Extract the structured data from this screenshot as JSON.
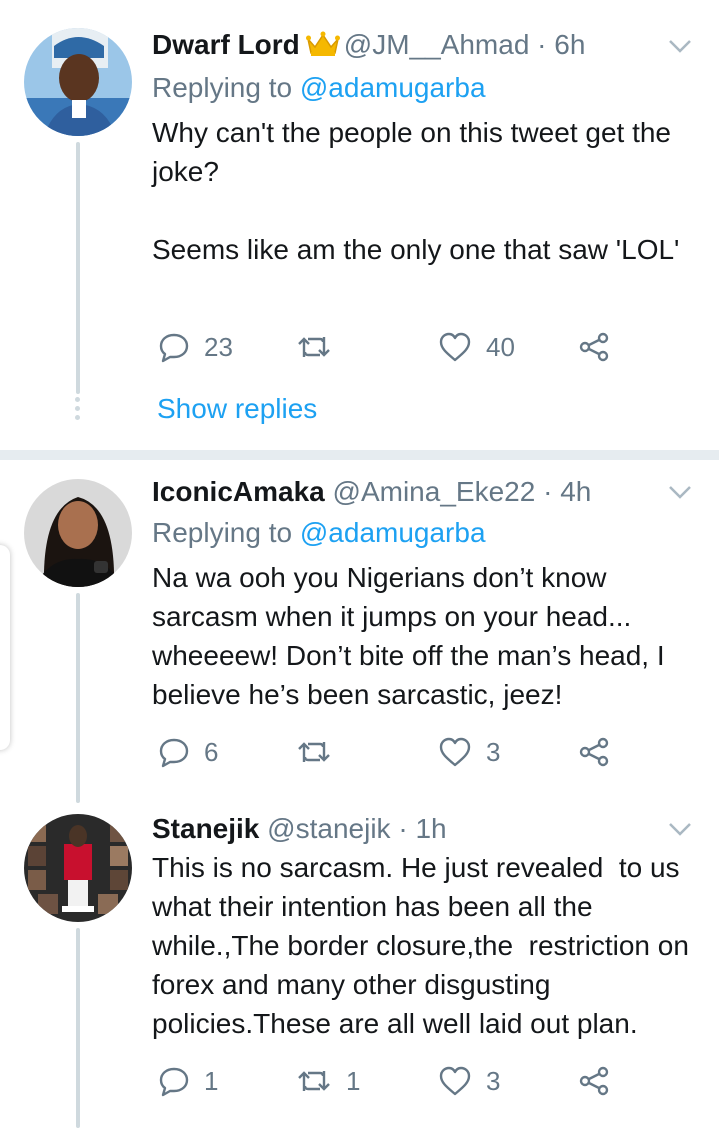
{
  "tweets": [
    {
      "name": "Dwarf Lord",
      "handle": "@JM__Ahmad",
      "time": "6h",
      "replying_prefix": "Replying to",
      "replying_to": "@adamugarba",
      "text": "Why can't the people on this tweet get the joke?\n\nSeems like am the only one that saw 'LOL'",
      "replies": "23",
      "retweets": "",
      "likes": "40",
      "show_replies": "Show replies",
      "icons": [
        "crown-emoji-icon",
        "chevron-down-icon",
        "reply-icon",
        "retweet-icon",
        "like-icon",
        "share-icon"
      ]
    },
    {
      "name": "IconicAmaka",
      "handle": "@Amina_Eke22",
      "time": "4h",
      "replying_prefix": "Replying to",
      "replying_to": "@adamugarba",
      "text": "Na wa ooh you Nigerians don’t know sarcasm when it jumps on your head... wheeeew! Don’t bite off the man’s head, I believe he’s been sarcastic, jeez!",
      "replies": "6",
      "retweets": "",
      "likes": "3"
    },
    {
      "name": "Stanejik",
      "handle": "@stanejik",
      "time": "1h",
      "text": "This is no sarcasm. He just revealed  to us what their intention has been all the while.,The border closure,the  restriction on forex and many other disgusting policies.These are all well laid out plan.",
      "replies": "1",
      "retweets": "1",
      "likes": "3"
    }
  ],
  "separator": " · ",
  "colors": {
    "link": "#1da1f2",
    "muted": "#657786",
    "text": "#14171a",
    "line": "#cfd9de"
  }
}
